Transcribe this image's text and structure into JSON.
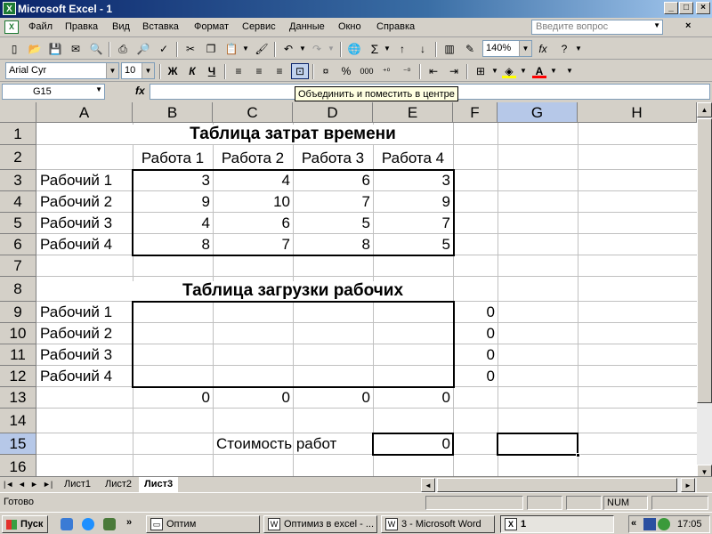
{
  "window": {
    "title": "Microsoft Excel - 1",
    "buttons": [
      "_",
      "□",
      "×"
    ]
  },
  "menu": {
    "items": [
      "Файл",
      "Правка",
      "Вид",
      "Вставка",
      "Формат",
      "Сервис",
      "Данные",
      "Окно",
      "Справка"
    ],
    "ask_placeholder": "Введите вопрос",
    "mdi_buttons": [
      "×"
    ]
  },
  "toolbar": {
    "zoom": "140%",
    "font_name": "Arial Cyr",
    "font_size": "10",
    "bold": "Ж",
    "italic": "К",
    "underline": "Ч",
    "percent": "%",
    "thousands": "000",
    "tooltip": "Объединить и поместить в центре"
  },
  "formula_bar": {
    "name_box": "G15",
    "fx": "fx",
    "formula": ""
  },
  "columns": [
    "A",
    "B",
    "C",
    "D",
    "E",
    "F",
    "G",
    "H"
  ],
  "rows": [
    "1",
    "2",
    "3",
    "4",
    "5",
    "6",
    "7",
    "8",
    "9",
    "10",
    "11",
    "12",
    "13",
    "14",
    "15",
    "16"
  ],
  "selected_cell": {
    "column": "G",
    "row": "15"
  },
  "sheet": {
    "title1": "Таблица затрат времени",
    "headers": [
      "Работа 1",
      "Работа 2",
      "Работа 3",
      "Работа 4"
    ],
    "workers1": [
      "Рабочий 1",
      "Рабочий 2",
      "Рабочий 3",
      "Рабочий 4"
    ],
    "time_values": [
      [
        "3",
        "4",
        "6",
        "3"
      ],
      [
        "9",
        "10",
        "7",
        "9"
      ],
      [
        "4",
        "6",
        "5",
        "7"
      ],
      [
        "8",
        "7",
        "8",
        "5"
      ]
    ],
    "title2": "Таблица загрузки рабочих",
    "workers2": [
      "Рабочий 1",
      "Рабочий 2",
      "Рабочий 3",
      "Рабочий 4"
    ],
    "row_sums": [
      "0",
      "0",
      "0",
      "0"
    ],
    "col_sums": [
      "0",
      "0",
      "0",
      "0"
    ],
    "cost_label": "Стоимость работ",
    "cost_value": "0"
  },
  "sheet_tabs": [
    "Лист1",
    "Лист2",
    "Лист3"
  ],
  "active_tab": "Лист3",
  "status": {
    "ready": "Готово",
    "num": "NUM"
  },
  "taskbar": {
    "start": "Пуск",
    "buttons": [
      "Оптим",
      "Оптимиз в excel - ...",
      "3 - Microsoft Word",
      "1"
    ],
    "active_button": "1",
    "time": "17:05"
  }
}
